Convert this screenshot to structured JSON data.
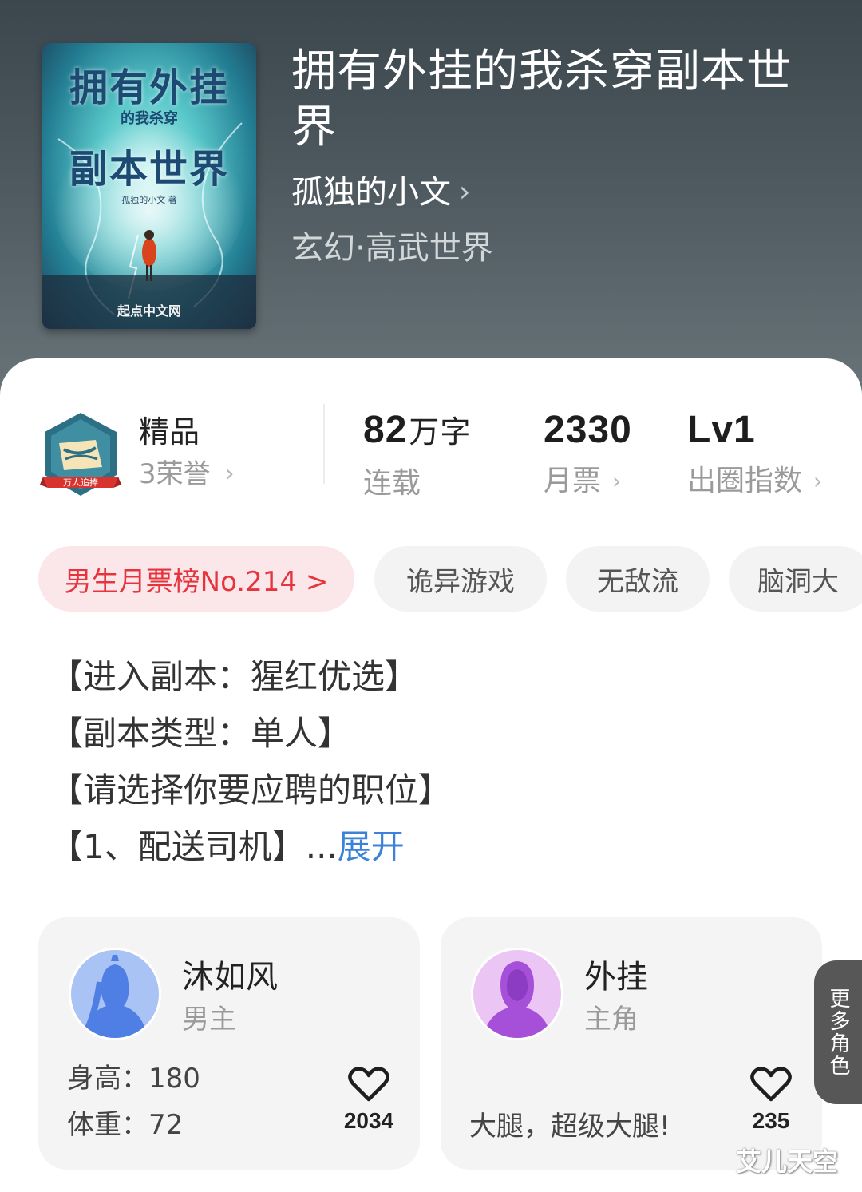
{
  "book": {
    "cover": {
      "title_line1": "拥有外挂",
      "title_line2": "的我杀穿",
      "title_line3": "副本世界",
      "author_credit": "孤独的小文 著",
      "publisher": "起点中文网"
    },
    "title": "拥有外挂的我杀穿副本世界",
    "author": "孤独的小文",
    "genre": "玄幻·高武世界"
  },
  "honor": {
    "badge_text": "万人追捧",
    "title": "精品",
    "subtitle": "3荣誉"
  },
  "stats": {
    "words": {
      "value": "82",
      "unit": "万字",
      "label": "连载"
    },
    "votes": {
      "value": "2330",
      "label": "月票"
    },
    "index": {
      "value": "Lv1",
      "label": "出圈指数"
    }
  },
  "tags": {
    "rank": "男生月票榜No.214 >",
    "items": [
      "诡异游戏",
      "无敌流",
      "脑洞大"
    ]
  },
  "intro": {
    "lines": [
      "【进入副本：猩红优选】",
      "【副本类型：单人】",
      "【请选择你要应聘的职位】",
      "【1、配送司机】"
    ],
    "ellipsis": "...",
    "expand": "展开"
  },
  "characters": [
    {
      "name": "沐如风",
      "role": "男主",
      "attr1_label": "身高：",
      "attr1_value": "180",
      "attr2_label": "体重：",
      "attr2_value": "72",
      "likes": "2034"
    },
    {
      "name": "外挂",
      "role": "主角",
      "description": "大腿，超级大腿!",
      "likes": "235"
    }
  ],
  "more_roles": "更多角色",
  "watermark": "艾儿天空",
  "colors": {
    "accent_blue": "#3b82d8",
    "rank_red": "#e5343e",
    "rank_bg": "#fbe7e9"
  },
  "icons": [
    "chevron-right-icon",
    "heart-icon",
    "honor-badge-icon"
  ]
}
